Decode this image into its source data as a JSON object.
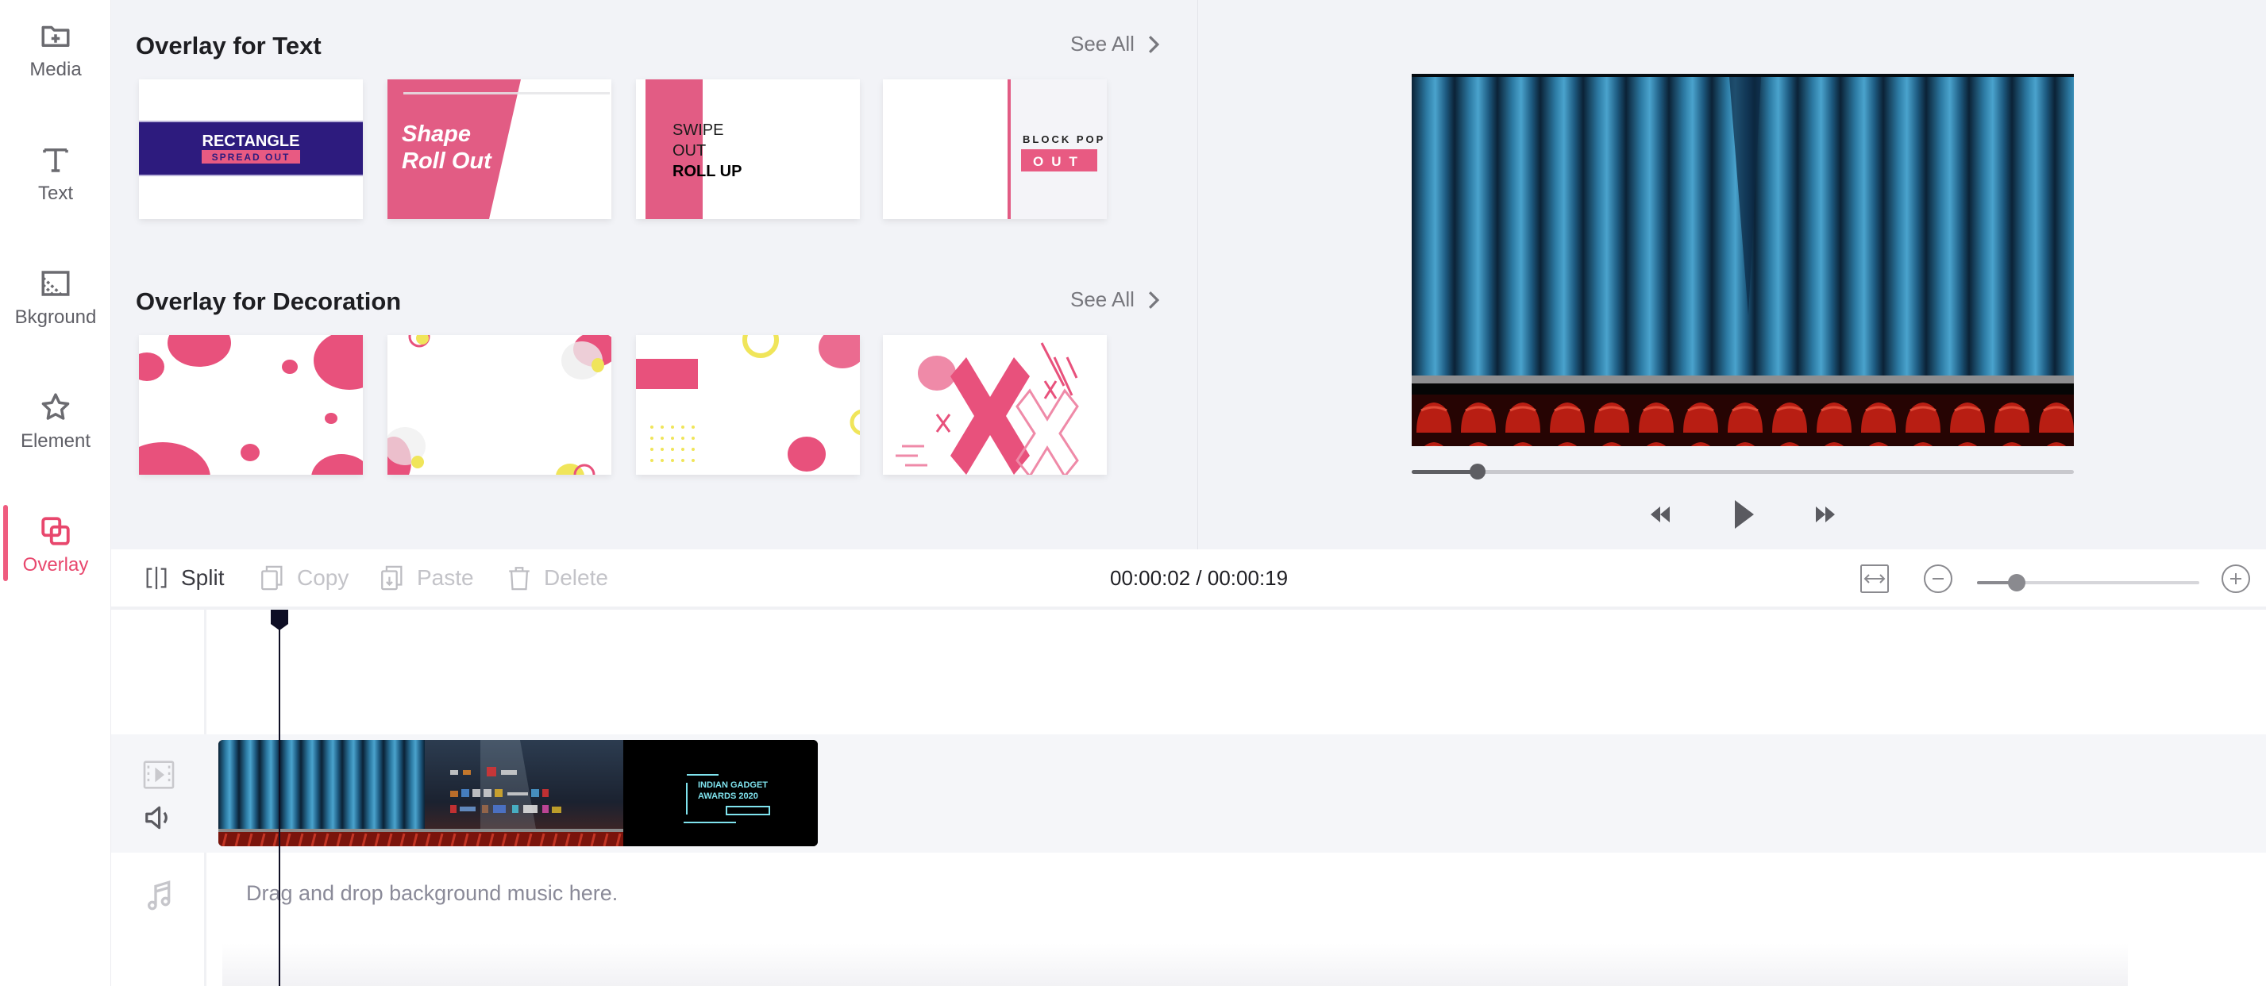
{
  "sidebar": {
    "items": [
      {
        "label": "Media",
        "icon": "folder-plus-icon",
        "active": false
      },
      {
        "label": "Text",
        "icon": "text-icon",
        "active": false
      },
      {
        "label": "Bkground",
        "icon": "background-icon",
        "active": false
      },
      {
        "label": "Element",
        "icon": "star-icon",
        "active": false
      },
      {
        "label": "Overlay",
        "icon": "overlay-icon",
        "active": true
      }
    ]
  },
  "library": {
    "sections": [
      {
        "title": "Overlay for Text",
        "see_all": "See All",
        "cards": [
          {
            "name": "rectangle-spread-out",
            "line1": "RECTANGLE",
            "line2": "SPREAD OUT"
          },
          {
            "name": "shape-roll-out",
            "line1": "Shape",
            "line2": "Roll Out"
          },
          {
            "name": "swipe-out-roll-up",
            "line1": "SWIPE",
            "line2": "OUT",
            "line3": "ROLL UP"
          },
          {
            "name": "block-pop-out",
            "line1": "BLOCK POP",
            "line2": "OUT"
          }
        ]
      },
      {
        "title": "Overlay for Decoration",
        "see_all": "See All",
        "cards": [
          {
            "name": "decoration-circles"
          },
          {
            "name": "decoration-corner-bubbles"
          },
          {
            "name": "decoration-geometric"
          },
          {
            "name": "decoration-crosses"
          }
        ]
      }
    ]
  },
  "preview": {
    "progress_percent": 10,
    "controls": [
      "rewind",
      "play",
      "fast-forward"
    ]
  },
  "toolbar": {
    "split": "Split",
    "copy": "Copy",
    "paste": "Paste",
    "delete": "Delete",
    "timecode": "00:00:02 / 00:00:19",
    "zoom_level_percent": 18
  },
  "timeline": {
    "music_placeholder": "Drag and drop background music here.",
    "clip_text": "INDIAN GADGET AWARDS 2020"
  },
  "colors": {
    "accent": "#e8476d",
    "pink": "#e85a82",
    "navy": "#2d1b7e",
    "yellow": "#f0e55a"
  }
}
